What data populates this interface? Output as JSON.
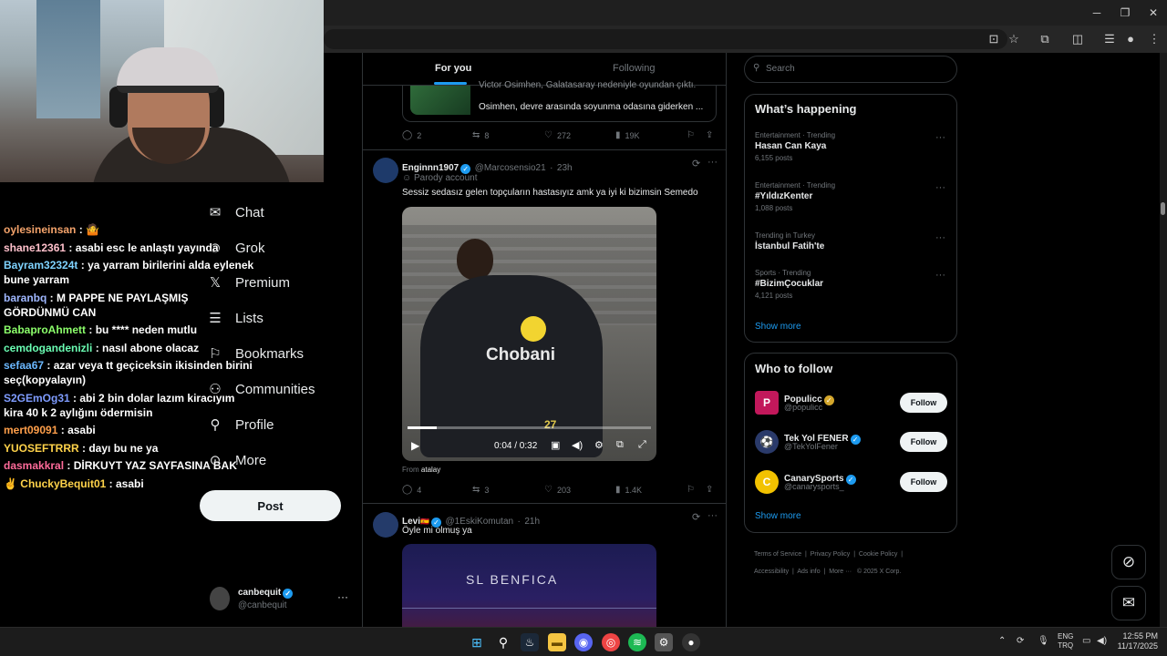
{
  "chat_messages": [
    {
      "user": "oylesineinsan",
      "text": "🤷",
      "color": "#f4a36b"
    },
    {
      "user": "shane12361",
      "text": "asabi esc le anlaştı yayında",
      "color": "#ffc0cb"
    },
    {
      "user": "Bayram32324t",
      "text": "ya yarram birilerini alda eylenek bune yarram",
      "color": "#7fd3ff"
    },
    {
      "user": "baranbq",
      "text": "M PAPPE NE PAYLAŞMIŞ GÖRDÜNMÜ CAN",
      "color": "#9fb7ff"
    },
    {
      "user": "BabaproAhmett",
      "text": "bu **** neden mutlu",
      "color": "#8cff6b"
    },
    {
      "user": "cemdogandenizli",
      "text": "nasıl abone olacaz",
      "color": "#6bffb4"
    },
    {
      "user": "sefaa67",
      "text": "azar veya tt geçiceksin ikisinden birini seç(kopyalayın)",
      "color": "#6bb8ff"
    },
    {
      "user": "S2GEmOg31",
      "text": "abi 2 bin dolar lazım kiracıyım kira 40 k 2 aylığını ödermisin",
      "color": "#7f9cff"
    },
    {
      "user": "mert09091",
      "text": "asabi",
      "color": "#ff9f4a"
    },
    {
      "user": "YUOSEFTRRR",
      "text": "dayı bu ne ya",
      "color": "#ffd34a"
    },
    {
      "user": "dasmakkral",
      "text": "DİRKUYT YAZ SAYFASINA BAK",
      "color": "#ff6b9a"
    },
    {
      "user": "ChuckyBequit01",
      "text": "asabi",
      "color": "#ffd34a",
      "prefix": "✌"
    }
  ],
  "nav": {
    "items": [
      {
        "label": "Chat",
        "icon": "mail-icon"
      },
      {
        "label": "Grok",
        "icon": "grok-icon"
      },
      {
        "label": "Premium",
        "icon": "x-logo-icon"
      },
      {
        "label": "Lists",
        "icon": "list-icon"
      },
      {
        "label": "Bookmarks",
        "icon": "bookmark-icon"
      },
      {
        "label": "Communities",
        "icon": "communities-icon"
      },
      {
        "label": "Profile",
        "icon": "person-icon"
      },
      {
        "label": "More",
        "icon": "more-circle-icon"
      }
    ],
    "post_label": "Post",
    "account_name": "canbequit",
    "account_handle": "@canbequit"
  },
  "feed": {
    "tabs": [
      "For you",
      "Following"
    ],
    "active_tab": "For you",
    "top_tweet": {
      "preview_line1": "Victor Osimhen, Galatasaray nedeniyle oyundan çıktı.",
      "preview_line2": "Osimhen, devre arasında soyunma odasına giderken ...",
      "replies": "2",
      "reposts": "8",
      "likes": "272",
      "views": "19K"
    },
    "tweet1": {
      "name": "Enginnn1907",
      "handle": "@Marcosensio21",
      "time": "23h",
      "badge": "Parody account",
      "text": "Sessiz sedasız gelen topçuların hastasıyız amk ya iyi ki bizimsin Semedo",
      "video_time": "0:04 / 0:32",
      "jersey_text": "Chobani",
      "jersey_number": "27",
      "from_label": "From",
      "from_user": "atalay",
      "replies": "4",
      "reposts": "3",
      "likes": "203",
      "views": "1.4K"
    },
    "tweet2": {
      "name": "Levi",
      "handle": "@1EskiKomutan",
      "time": "21h",
      "text": "Öyle mi olmuş ya",
      "image_text": "SL BENFICA"
    }
  },
  "search": {
    "placeholder": "Search"
  },
  "trending": {
    "title": "What’s happening",
    "items": [
      {
        "meta": "Entertainment · Trending",
        "name": "Hasan Can Kaya",
        "count": "6,155 posts"
      },
      {
        "meta": "Entertainment · Trending",
        "name": "#YıldızKenter",
        "count": "1,088 posts"
      },
      {
        "meta": "Trending in Turkey",
        "name": "İstanbul Fatih'te",
        "count": ""
      },
      {
        "meta": "Sports · Trending",
        "name": "#BizimÇocuklar",
        "count": "4,121 posts"
      }
    ],
    "show_more": "Show more"
  },
  "who_to_follow": {
    "title": "Who to follow",
    "accounts": [
      {
        "name": "Populicc",
        "handle": "@populicc",
        "badge": "gold",
        "avatar_color": "#c2185b",
        "avatar_letter": "P"
      },
      {
        "name": "Tek Yol FENER",
        "handle": "@TekYolFener",
        "badge": "blue",
        "avatar_color": "#2a3a6a",
        "avatar_letter": "⚽"
      },
      {
        "name": "CanarySports",
        "handle": "@canarysports_",
        "badge": "blue",
        "avatar_color": "#f2c200",
        "avatar_letter": "C"
      }
    ],
    "follow_label": "Follow",
    "show_more": "Show more"
  },
  "footer": {
    "links": [
      "Terms of Service",
      "Privacy Policy",
      "Cookie Policy",
      "Accessibility",
      "Ads info",
      "More ···",
      "© 2025 X Corp."
    ]
  },
  "taskbar": {
    "lang_top": "ENG",
    "lang_bottom": "TRQ",
    "time": "12:55 PM",
    "date": "11/17/2025"
  },
  "colors": {
    "accent": "#1d9bf0",
    "background": "#000000",
    "border": "#2f3336"
  }
}
